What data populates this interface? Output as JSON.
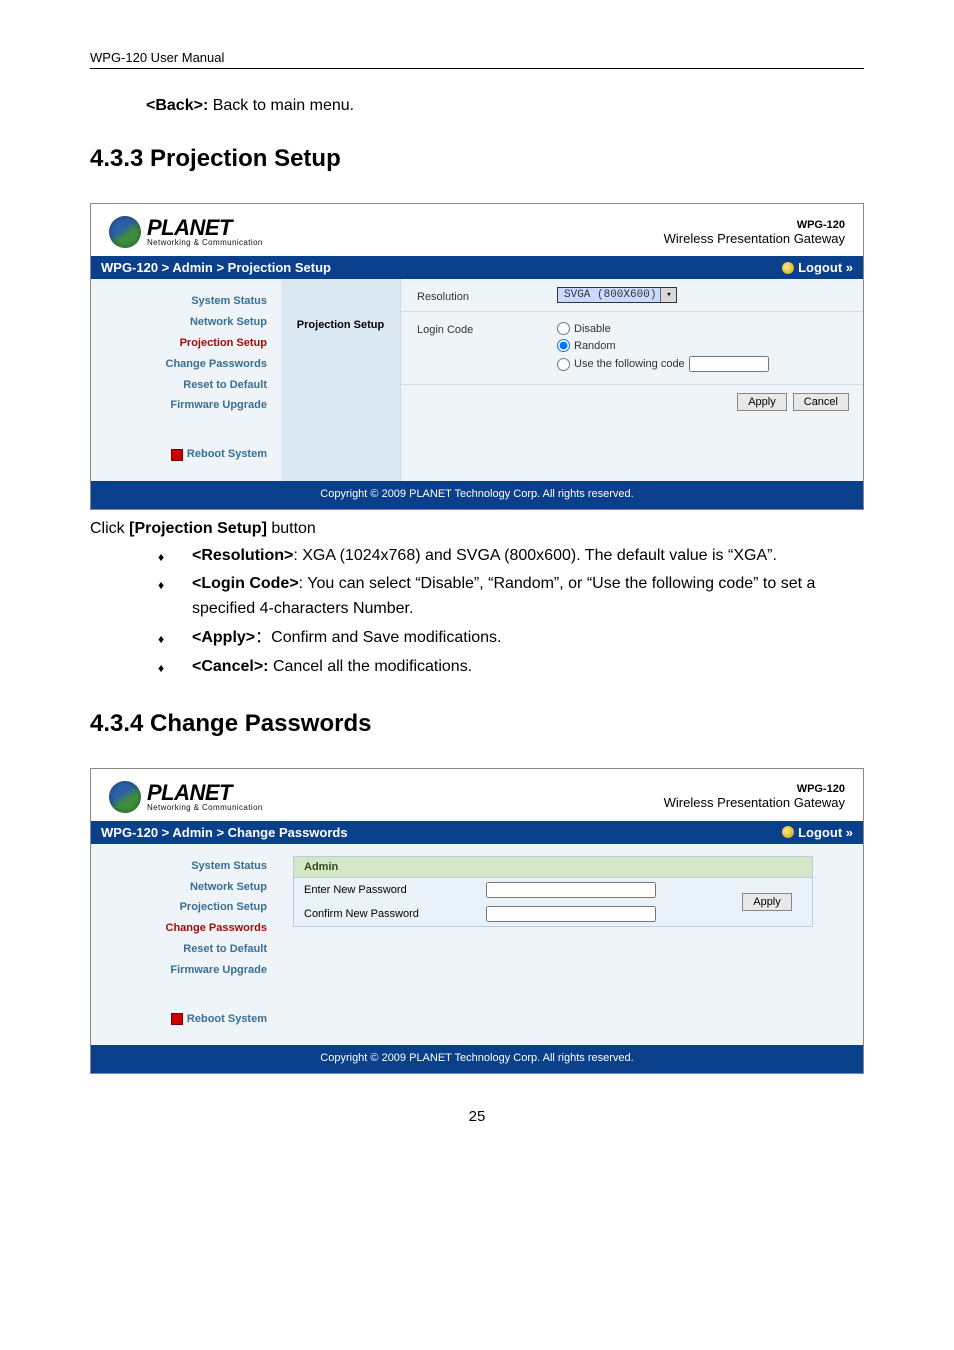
{
  "doc": {
    "header": "WPG-120 User Manual",
    "back_label": "<Back>:",
    "back_text": " Back to main menu.",
    "section1": "4.3.3  Projection Setup",
    "click_line_prefix": "Click ",
    "click_line_bold": "[Projection Setup]",
    "click_line_suffix": " button",
    "bullets1": [
      {
        "b": "<Resolution>",
        "sep": ": ",
        "t": "XGA (1024x768) and SVGA (800x600). The default value is “XGA”."
      },
      {
        "b": "<Login Code>",
        "sep": ": ",
        "t": "You can select “Disable”, “Random”, or “Use the following code” to set a specified 4-characters Number."
      },
      {
        "b": "<Apply>",
        "sep": "：",
        "t": "Confirm and Save modifications."
      },
      {
        "b": "<Cancel>:",
        "sep": " ",
        "t": "Cancel all the modifications."
      }
    ],
    "section2": "4.3.4  Change Passwords",
    "page_number": "25"
  },
  "brand": {
    "name": "PLANET",
    "tag": "Networking & Communication",
    "model": "WPG-120",
    "subtitle": "Wireless Presentation Gateway"
  },
  "common": {
    "logout": "Logout »",
    "copyright": "Copyright © 2009 PLANET Technology Corp. All rights reserved."
  },
  "sidebar": {
    "items": [
      {
        "label": "System Status",
        "key": "system-status"
      },
      {
        "label": "Network Setup",
        "key": "network-setup"
      },
      {
        "label": "Projection Setup",
        "key": "projection-setup"
      },
      {
        "label": "Change Passwords",
        "key": "change-passwords"
      },
      {
        "label": "Reset to Default",
        "key": "reset-to-default"
      },
      {
        "label": "Firmware Upgrade",
        "key": "firmware-upgrade"
      }
    ],
    "reboot": "Reboot System"
  },
  "panel1": {
    "breadcrumb": "WPG-120 > Admin > Projection Setup",
    "label": "Projection Setup",
    "rows": {
      "resolution_label": "Resolution",
      "resolution_value": "SVGA (800X600)",
      "login_label": "Login Code",
      "radio_disable": "Disable",
      "radio_random": "Random",
      "radio_custom": "Use the following code",
      "radio_custom_value": ""
    },
    "buttons": {
      "apply": "Apply",
      "cancel": "Cancel"
    }
  },
  "panel2": {
    "breadcrumb": "WPG-120 > Admin > Change Passwords",
    "pw_title": "Admin",
    "enter_label": "Enter New Password",
    "confirm_label": "Confirm New Password",
    "enter_value": "",
    "confirm_value": "",
    "apply": "Apply"
  }
}
